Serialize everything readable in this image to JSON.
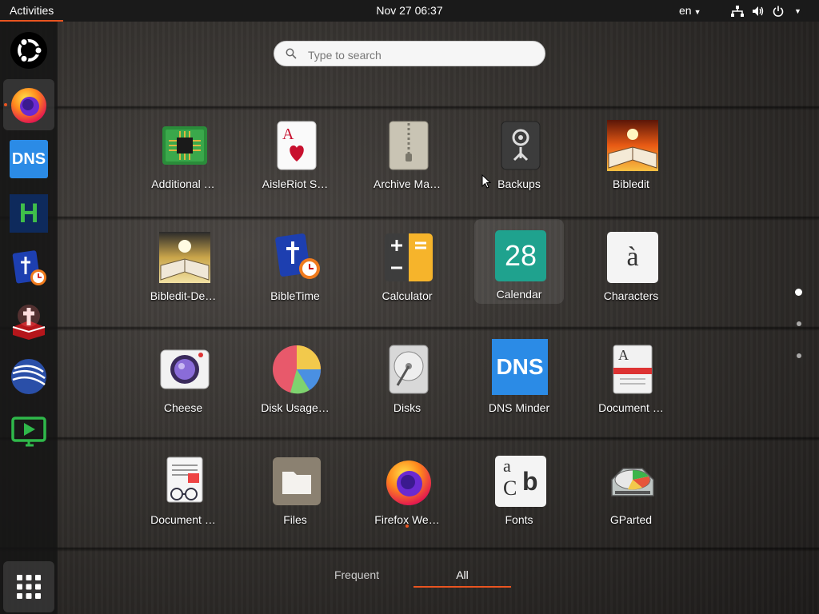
{
  "topbar": {
    "activities": "Activities",
    "clock": "Nov 27  06:37",
    "language": "en"
  },
  "dock": {
    "items": [
      {
        "name": "ubuntu-logo"
      },
      {
        "name": "firefox",
        "running": true
      },
      {
        "name": "dns-minder",
        "text": "DNS"
      },
      {
        "name": "h-app",
        "text": "H"
      },
      {
        "name": "bibletime"
      },
      {
        "name": "bible-app"
      },
      {
        "name": "globe-app"
      },
      {
        "name": "screencast-app"
      },
      {
        "name": "show-applications"
      }
    ]
  },
  "search": {
    "placeholder": "Type to search"
  },
  "apps": [
    {
      "label": "Additional …"
    },
    {
      "label": "AisleRiot S…"
    },
    {
      "label": "Archive Ma…"
    },
    {
      "label": "Backups"
    },
    {
      "label": "Bibledit"
    },
    {
      "label": "Bibledit-De…"
    },
    {
      "label": "BibleTime"
    },
    {
      "label": "Calculator"
    },
    {
      "label": "Calendar",
      "icon_text": "28"
    },
    {
      "label": "Characters",
      "icon_text": "à"
    },
    {
      "label": "Cheese"
    },
    {
      "label": "Disk Usage…"
    },
    {
      "label": "Disks"
    },
    {
      "label": "DNS Minder",
      "icon_text": "DNS"
    },
    {
      "label": "Document …",
      "icon_text": "A"
    },
    {
      "label": "Document …"
    },
    {
      "label": "Files"
    },
    {
      "label": "Firefox We…"
    },
    {
      "label": "Fonts"
    },
    {
      "label": "GParted"
    }
  ],
  "tabs": {
    "frequent": "Frequent",
    "all": "All"
  },
  "colors": {
    "accent": "#e95420",
    "topbar": "#1a1a1a"
  }
}
